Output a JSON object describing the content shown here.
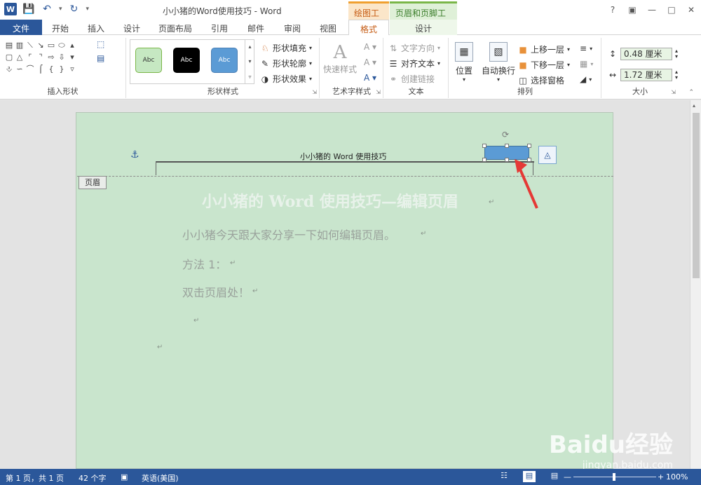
{
  "window": {
    "title": "小小猪的Word使用技巧 - Word",
    "ctx_draw": "绘图工具",
    "ctx_hf": "页眉和页脚工具"
  },
  "tabs": {
    "file": "文件",
    "home": "开始",
    "insert": "插入",
    "design": "设计",
    "layout": "页面布局",
    "refs": "引用",
    "mail": "邮件",
    "review": "审阅",
    "view": "视图",
    "format": "格式",
    "hf_design": "设计"
  },
  "ribbon": {
    "insert_shapes_label": "插入形状",
    "shape_styles_label": "形状样式",
    "style_sample": "Abc",
    "shape_fill": "形状填充",
    "shape_outline": "形状轮廓",
    "shape_effects": "形状效果",
    "quick_styles": "快速样式",
    "wordart_label": "艺术字样式",
    "text_direction": "文字方向",
    "align_text": "对齐文本",
    "create_link": "创建链接",
    "text_label": "文本",
    "position": "位置",
    "wrap_text": "自动换行",
    "bring_forward": "上移一层",
    "send_backward": "下移一层",
    "selection_pane": "选择窗格",
    "arrange_label": "排列",
    "height_value": "0.48 厘米",
    "width_value": "1.72 厘米",
    "size_label": "大小"
  },
  "document": {
    "header_text": "小小猪的 Word 使用技巧",
    "header_tag": "页眉",
    "heading": "小小猪的 Word 使用技巧—编辑页眉",
    "para1": "小小猪今天跟大家分享一下如何编辑页眉。",
    "para2": "方法 1：",
    "para3": "双击页眉处！"
  },
  "status": {
    "page": "第 1 页，共 1 页",
    "words": "42 个字",
    "language": "英语(美国)",
    "zoom": "100%"
  },
  "watermark": {
    "brand": "Baidu经验",
    "url": "jingyan.baidu.com"
  },
  "colors": {
    "accent": "#2b579a",
    "page_bg": "#c9e5cd",
    "shape_fill": "#5b9bd5",
    "arrow": "#e53935"
  }
}
